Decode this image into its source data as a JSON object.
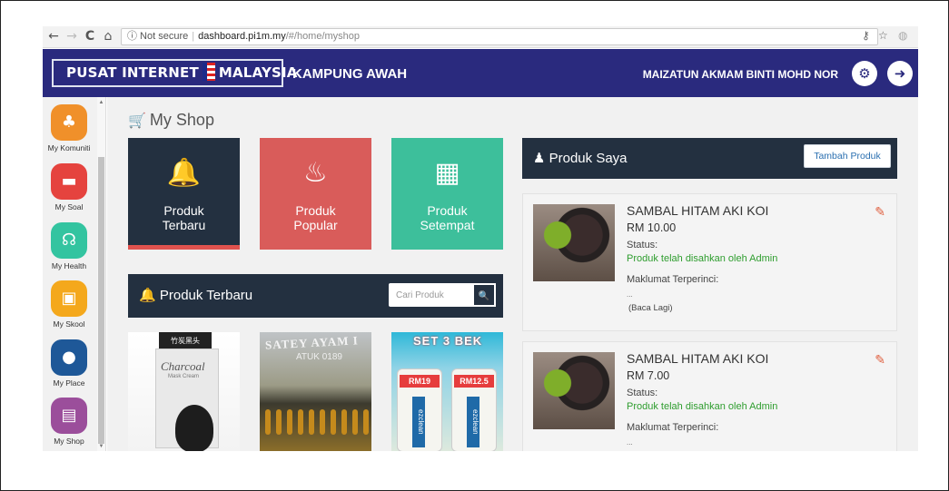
{
  "browser": {
    "nav": {
      "back": "←",
      "forward": "→",
      "reload": "C",
      "home": "⌂"
    },
    "security_label": "ⓘ Not secure",
    "url_host": "dashboard.pi1m.my",
    "url_path": "/#/home/myshop",
    "key_icon": "⚷",
    "star_icon": "☆",
    "menu_icon": "◍"
  },
  "header": {
    "logo_left": "PUSAT INTERNET",
    "logo_right": "MALAYSIA",
    "village": "KAMPUNG AWAH",
    "user_name": "MAIZATUN AKMAM BINTI MOHD NOR",
    "settings_icon": "⚙",
    "logout_icon": "➜"
  },
  "sidebar": {
    "items": [
      {
        "label": "My Komuniti",
        "color": "#f0902a",
        "icon": "people-icon",
        "glyph": "♣"
      },
      {
        "label": "My Soal",
        "color": "#e5433e",
        "icon": "cup-icon",
        "glyph": "▬"
      },
      {
        "label": "My Health",
        "color": "#33c4a0",
        "icon": "stethoscope-icon",
        "glyph": "☊"
      },
      {
        "label": "My Skool",
        "color": "#f4a81c",
        "icon": "shield-icon",
        "glyph": "▣"
      },
      {
        "label": "My Place",
        "color": "#1e5898",
        "icon": "map-pin-icon",
        "glyph": "●"
      },
      {
        "label": "My Shop",
        "color": "#9b4e9b",
        "icon": "cart-icon",
        "glyph": "▤"
      }
    ]
  },
  "main": {
    "title": "My Shop",
    "tiles": [
      {
        "label": "Produk\nTerbaru",
        "icon": "bell-icon",
        "glyph": "🔔"
      },
      {
        "label": "Produk\nPopular",
        "icon": "fire-icon",
        "glyph": "♨"
      },
      {
        "label": "Produk\nSetempat",
        "icon": "cubes-icon",
        "glyph": "▦"
      }
    ],
    "terbaru_bar": {
      "title": "Produk Terbaru",
      "search_placeholder": "Cari Produk",
      "search_icon": "🔍"
    },
    "thumbnails": {
      "t1_brand": "竹炭黑头",
      "t1_word": "Charcoal",
      "t1_sub": "Mask Cream",
      "t2_word": "SATEY AYAM I",
      "t2_sub": "ATUK 0189",
      "t3_word": "SET 3 BEK",
      "t3_price_a": "RM19",
      "t3_price_b": "RM12.5",
      "t3_brand": "ezclean"
    }
  },
  "produk_saya": {
    "title": "Produk Saya",
    "add_button": "Tambah Produk",
    "products": [
      {
        "name": "SAMBAL HITAM AKI KOI",
        "price": "RM 10.00",
        "status_label": "Status:",
        "status": "Produk telah disahkan oleh Admin",
        "detail_label": "Maklumat Terperinci:",
        "detail": "...",
        "read_more": "(Baca Lagi)"
      },
      {
        "name": "SAMBAL HITAM AKI KOI",
        "price": "RM 7.00",
        "status_label": "Status:",
        "status": "Produk telah disahkan oleh Admin",
        "detail_label": "Maklumat Terperinci:",
        "detail": "...",
        "read_more": ""
      }
    ]
  }
}
